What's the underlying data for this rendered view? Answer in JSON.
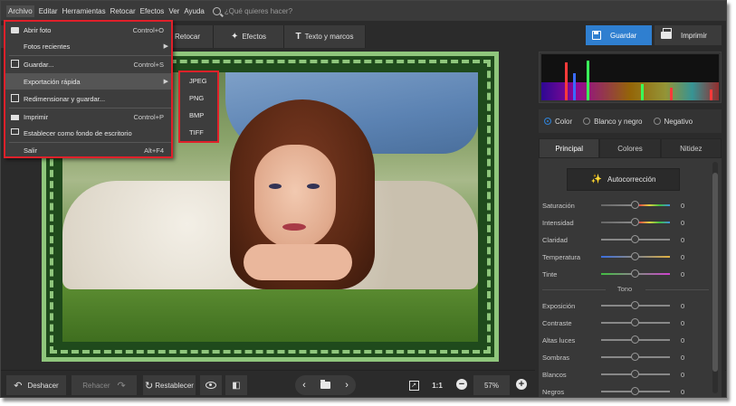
{
  "menubar": {
    "items": [
      "Archivo",
      "Editar",
      "Herramientas",
      "Retocar",
      "Efectos",
      "Ver",
      "Ayuda"
    ],
    "search_placeholder": "¿Qué quieres hacer?"
  },
  "toolbar": {
    "tabs": [
      {
        "label": "Retocar",
        "icon": "retouch-icon"
      },
      {
        "label": "Efectos",
        "icon": "magic-wand-icon"
      },
      {
        "label": "Texto y marcos",
        "icon": "text-icon"
      }
    ],
    "save_label": "Guardar",
    "print_label": "Imprimir"
  },
  "file_menu": {
    "items": [
      {
        "label": "Abrir foto",
        "shortcut": "Control+O",
        "icon": "folder-icon"
      },
      {
        "label": "Fotos recientes",
        "shortcut": "",
        "submenu": true
      },
      {
        "label": "Guardar...",
        "shortcut": "Control+S",
        "icon": "floppy-icon"
      },
      {
        "label": "Exportación rápida",
        "shortcut": "",
        "submenu": true,
        "highlighted": true
      },
      {
        "label": "Redimensionar y guardar...",
        "shortcut": "",
        "icon": "resize-icon"
      },
      {
        "label": "Imprimir",
        "shortcut": "Control+P",
        "icon": "printer-icon"
      },
      {
        "label": "Establecer como fondo de escritorio",
        "shortcut": "",
        "icon": "monitor-icon"
      },
      {
        "label": "Salir",
        "shortcut": "Alt+F4"
      }
    ]
  },
  "export_submenu": {
    "items": [
      "JPEG",
      "PNG",
      "BMP",
      "TIFF"
    ]
  },
  "bottombar": {
    "undo_label": "Deshacer",
    "redo_label": "Rehacer",
    "reset_label": "Restablecer",
    "zoom_1to1": "1:1",
    "zoom_level": "57%"
  },
  "right_panel": {
    "modes": [
      {
        "label": "Color",
        "selected": true
      },
      {
        "label": "Blanco y negro",
        "selected": false
      },
      {
        "label": "Negativo",
        "selected": false
      }
    ],
    "tabs": [
      {
        "label": "Principal",
        "active": true
      },
      {
        "label": "Colores",
        "active": false
      },
      {
        "label": "Nitidez",
        "active": false
      }
    ],
    "autocorrect_label": "Autocorrección",
    "section_tono": "Tono",
    "sliders": [
      {
        "label": "Saturación",
        "value": "0"
      },
      {
        "label": "Intensidad",
        "value": "0"
      },
      {
        "label": "Claridad",
        "value": "0"
      },
      {
        "label": "Temperatura",
        "value": "0"
      },
      {
        "label": "Tinte",
        "value": "0"
      }
    ],
    "tone_sliders": [
      {
        "label": "Exposición",
        "value": "0"
      },
      {
        "label": "Contraste",
        "value": "0"
      },
      {
        "label": "Altas luces",
        "value": "0"
      },
      {
        "label": "Sombras",
        "value": "0"
      },
      {
        "label": "Blancos",
        "value": "0"
      },
      {
        "label": "Negros",
        "value": "0"
      }
    ]
  },
  "colors": {
    "accent": "#2f7fd0",
    "highlight_box": "#e0202a",
    "frame_light": "#8fc67c",
    "frame_dark": "#1f4a1c"
  }
}
